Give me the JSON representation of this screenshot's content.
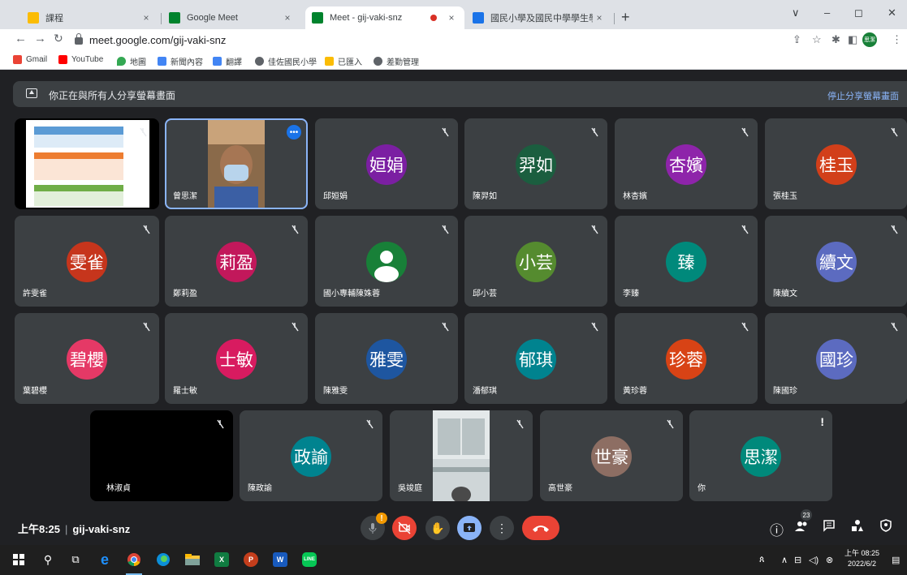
{
  "browser": {
    "tabs": [
      {
        "title": "課程",
        "close": "×",
        "favicon_color": "#fbbc04"
      },
      {
        "title": "Google Meet",
        "close": "×",
        "favicon_color": "#00832d"
      },
      {
        "title": "Meet - gij-vaki-snz",
        "close": "×",
        "favicon_color": "#00832d"
      },
      {
        "title": "國民小學及國民中學學生學習扶",
        "close": "×",
        "favicon_color": "#1a73e8"
      }
    ],
    "new_tab": "+",
    "window_controls": [
      "∨",
      "–",
      "◻",
      "✕"
    ],
    "url": "meet.google.com/gij-vaki-snz",
    "profile_initials": "思潔",
    "bookmarks": [
      {
        "label": "Gmail",
        "icon_color": "#ea4335"
      },
      {
        "label": "YouTube",
        "icon_color": "#ff0000"
      },
      {
        "label": "地圖",
        "icon_color": "#34a853"
      },
      {
        "label": "新聞內容",
        "icon_color": "#4285f4"
      },
      {
        "label": "翻譯",
        "icon_color": "#4285f4"
      },
      {
        "label": "佳佐國民小學",
        "icon_color": "#5f6368"
      },
      {
        "label": "已匯入",
        "icon_color": "#fbbc04"
      },
      {
        "label": "差勤管理",
        "icon_color": "#5f6368"
      }
    ]
  },
  "banner": {
    "text": "你正在與所有人分享螢幕畫面",
    "stop_label": "停止分享螢幕畫面"
  },
  "participants": [
    {
      "name": "",
      "initials": "",
      "type": "screen"
    },
    {
      "name": "曾思潔",
      "initials": "",
      "type": "video",
      "selected": true
    },
    {
      "name": "邱姮娟",
      "initials": "姮娟",
      "color": "#7b1fa2"
    },
    {
      "name": "陳羿如",
      "initials": "羿如",
      "color": "#1b5e3f"
    },
    {
      "name": "林杏嬪",
      "initials": "杏嬪",
      "color": "#8e24aa"
    },
    {
      "name": "張桂玉",
      "initials": "桂玉",
      "color": "#d23f1a"
    },
    {
      "name": "許雯雀",
      "initials": "雯雀",
      "color": "#c6351c"
    },
    {
      "name": "鄭莉盈",
      "initials": "莉盈",
      "color": "#c2185b"
    },
    {
      "name": "國小專輔陳姝蓉",
      "initials": "",
      "color": "#188038",
      "type": "generic"
    },
    {
      "name": "邱小芸",
      "initials": "小芸",
      "color": "#558b2f"
    },
    {
      "name": "李臻",
      "initials": "臻",
      "color": "#00897b"
    },
    {
      "name": "陳續文",
      "initials": "續文",
      "color": "#5c6bc0"
    },
    {
      "name": "葉碧櫻",
      "initials": "碧櫻",
      "color": "#e53966"
    },
    {
      "name": "羅士敏",
      "initials": "士敏",
      "color": "#d81b60"
    },
    {
      "name": "陳雅雯",
      "initials": "雅雯",
      "color": "#1e56a0"
    },
    {
      "name": "潘郁琪",
      "initials": "郁琪",
      "color": "#00838f"
    },
    {
      "name": "黃珍蓉",
      "initials": "珍蓉",
      "color": "#d84315"
    },
    {
      "name": "陳國珍",
      "initials": "國珍",
      "color": "#5c6bc0"
    },
    {
      "name": "林淑貞",
      "initials": "",
      "type": "black"
    },
    {
      "name": "陳政諭",
      "initials": "政諭",
      "color": "#00838f"
    },
    {
      "name": "吳竣庭",
      "initials": "",
      "type": "video2"
    },
    {
      "name": "高世豪",
      "initials": "世豪",
      "color": "#8d6e63"
    },
    {
      "name": "你",
      "initials": "思潔",
      "color": "#00897b",
      "type": "self"
    }
  ],
  "bottom": {
    "time": "上午8:25",
    "separator": "|",
    "meeting_code": "gij-vaki-snz",
    "participant_count": "23"
  },
  "taskbar": {
    "clock_time": "上午 08:25",
    "clock_date": "2022/6/2"
  }
}
